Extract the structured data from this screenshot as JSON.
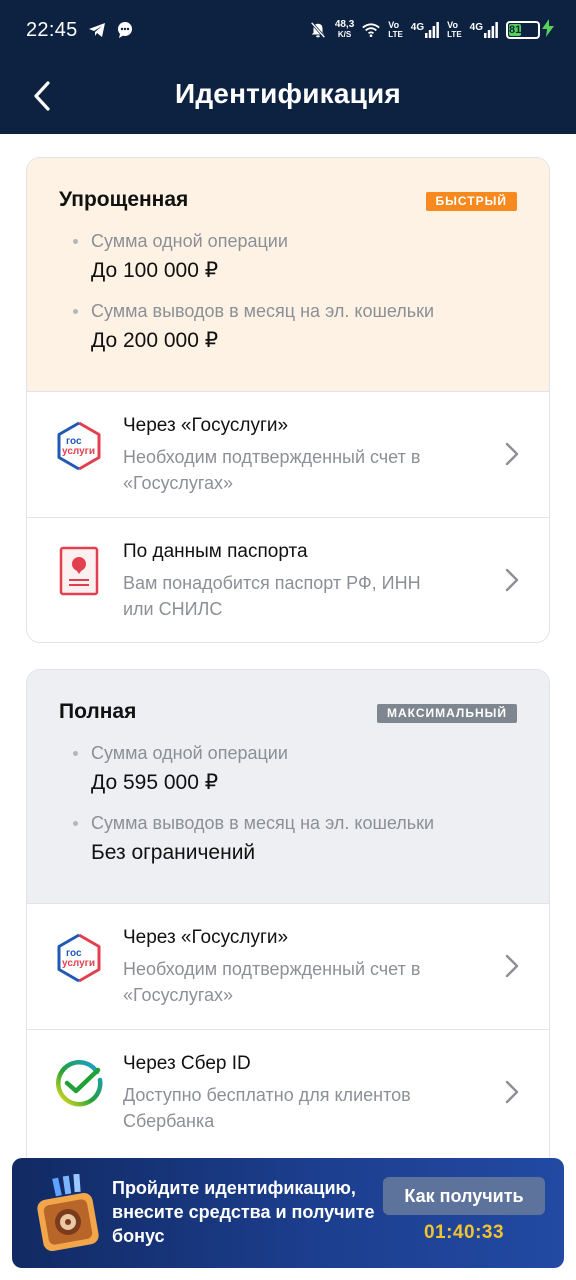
{
  "status_bar": {
    "time": "22:45",
    "net_speed_value": "48,3",
    "net_speed_unit": "K/S",
    "sim1_label_top": "Vo",
    "sim1_label_bottom": "LTE",
    "sim1_network": "4G",
    "sim2_label_top": "Vo",
    "sim2_label_bottom": "LTE",
    "sim2_network": "4G",
    "battery": "81",
    "icons": [
      "telegram-icon",
      "chat-icon",
      "mute-icon",
      "wifi-icon",
      "signal-icon",
      "battery-icon",
      "charging-icon"
    ]
  },
  "header": {
    "title": "Идентификация"
  },
  "simple": {
    "title": "Упрощенная",
    "badge": "БЫСТРЫЙ",
    "badge_color": "#f7891f",
    "bg_color": "#fdf2e4",
    "limits": [
      {
        "label": "Сумма одной операции",
        "value": "До 100 000 ₽"
      },
      {
        "label": "Сумма выводов в месяц на эл. кошельки",
        "value": "До 200 000 ₽"
      }
    ],
    "methods": [
      {
        "title": "Через «Госуслуги»",
        "desc": "Необходим подтвержденный счет в «Госуслугах»",
        "icon": "gosuslugi-icon",
        "icon_text_1": "гос",
        "icon_text_2": "услуги"
      },
      {
        "title": "По данным паспорта",
        "desc": "Вам понадобится паспорт РФ, ИНН или СНИЛС",
        "icon": "passport-icon"
      }
    ]
  },
  "full": {
    "title": "Полная",
    "badge": "МАКСИМАЛЬНЫЙ",
    "badge_color": "#7e8690",
    "bg_color": "#edeff2",
    "limits": [
      {
        "label": "Сумма одной операции",
        "value": "До 595 000 ₽"
      },
      {
        "label": "Сумма выводов в месяц на эл. кошельки",
        "value": "Без ограничений"
      }
    ],
    "methods": [
      {
        "title": "Через «Госуслуги»",
        "desc": "Необходим подтвержденный счет в «Госуслугах»",
        "icon": "gosuslugi-icon",
        "icon_text_1": "гос",
        "icon_text_2": "услуги"
      },
      {
        "title": "Через Сбер ID",
        "desc": "Доступно бесплатно для клиентов Сбербанка",
        "icon": "sber-id-icon"
      }
    ]
  },
  "banner": {
    "text": "Пройдите идентификацию, внесите средства и получите бонус",
    "button": "Как получить",
    "timer": "01:40:33",
    "icon": "safe-gift-icon"
  },
  "colors": {
    "header_bg": "#0d2241",
    "timer": "#f2c230",
    "gosuslugi_blue": "#1f59b5",
    "gosuslugi_red": "#e2404f",
    "sber_green": "#21a038"
  }
}
